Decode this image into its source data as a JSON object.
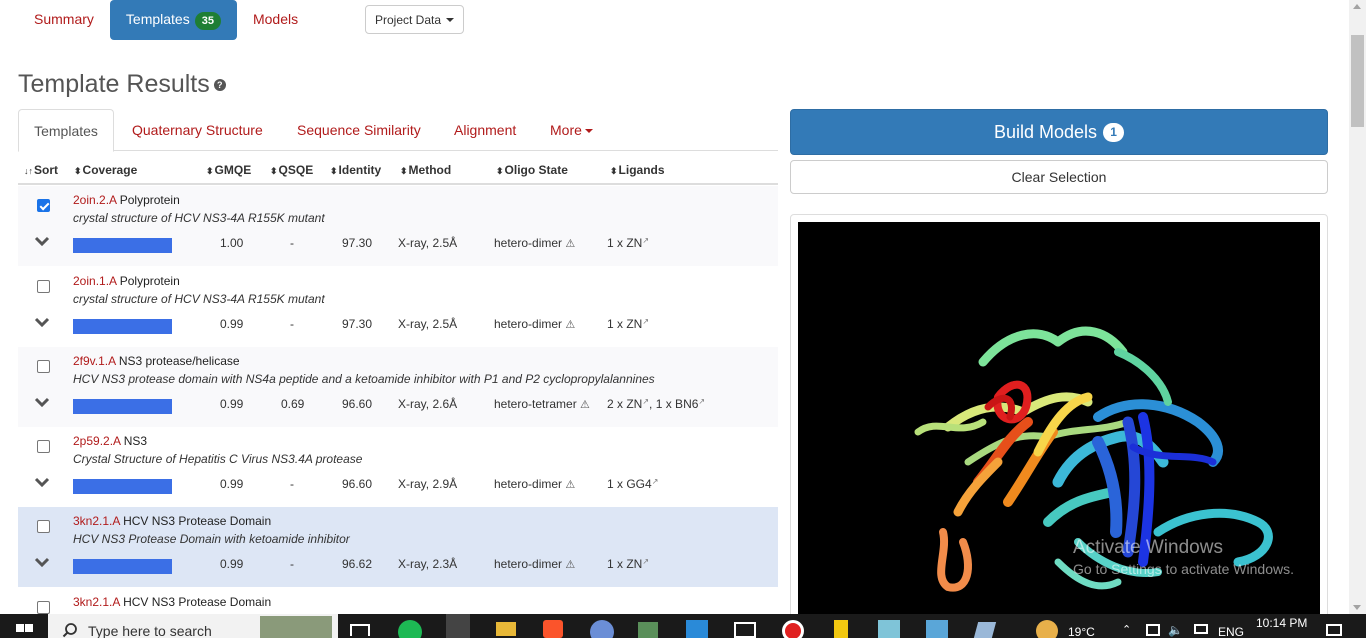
{
  "nav": {
    "tabs": [
      {
        "label": "Summary"
      },
      {
        "label": "Templates",
        "badge": "35"
      },
      {
        "label": "Models"
      }
    ],
    "project_data_label": "Project Data"
  },
  "title": "Template Results",
  "subtabs": [
    {
      "label": "Templates"
    },
    {
      "label": "Quaternary Structure"
    },
    {
      "label": "Sequence Similarity"
    },
    {
      "label": "Alignment"
    },
    {
      "label": "More"
    }
  ],
  "columns": {
    "sort": "Sort",
    "coverage": "Coverage",
    "gmqe": "GMQE",
    "qsqe": "QSQE",
    "identity": "Identity",
    "method": "Method",
    "oligo": "Oligo State",
    "ligands": "Ligands"
  },
  "rows": [
    {
      "checked": true,
      "id": "2oin.2.A",
      "name": "Polyprotein",
      "desc": "crystal structure of HCV NS3-4A R155K mutant",
      "gmqe": "1.00",
      "qsqe": "-",
      "identity": "97.30",
      "method": "X-ray, 2.5Å",
      "oligo": "hetero-dimer",
      "ligand1": "1 x ZN",
      "ligand2": ""
    },
    {
      "checked": false,
      "id": "2oin.1.A",
      "name": "Polyprotein",
      "desc": "crystal structure of HCV NS3-4A R155K mutant",
      "gmqe": "0.99",
      "qsqe": "-",
      "identity": "97.30",
      "method": "X-ray, 2.5Å",
      "oligo": "hetero-dimer",
      "ligand1": "1 x ZN",
      "ligand2": ""
    },
    {
      "checked": false,
      "id": "2f9v.1.A",
      "name": "NS3 protease/helicase",
      "desc": "HCV NS3 protease domain with NS4a peptide and a ketoamide inhibitor with P1 and P2 cyclopropylalannines",
      "gmqe": "0.99",
      "qsqe": "0.69",
      "identity": "96.60",
      "method": "X-ray, 2.6Å",
      "oligo": "hetero-tetramer",
      "ligand1": "2 x ZN",
      "ligand2": "1 x BN6"
    },
    {
      "checked": false,
      "id": "2p59.2.A",
      "name": "NS3",
      "desc": "Crystal Structure of Hepatitis C Virus NS3.4A protease",
      "gmqe": "0.99",
      "qsqe": "-",
      "identity": "96.60",
      "method": "X-ray, 2.9Å",
      "oligo": "hetero-dimer",
      "ligand1": "1 x GG4",
      "ligand2": ""
    },
    {
      "checked": false,
      "id": "3kn2.1.A",
      "name": "HCV NS3 Protease Domain",
      "desc": "HCV NS3 Protease Domain with ketoamide inhibitor",
      "gmqe": "0.99",
      "qsqe": "-",
      "identity": "96.62",
      "method": "X-ray, 2.3Å",
      "oligo": "hetero-dimer",
      "ligand1": "1 x ZN",
      "ligand2": ""
    },
    {
      "checked": false,
      "id": "3kn2.1.A",
      "name": "HCV NS3 Protease Domain",
      "desc": "",
      "gmqe": "",
      "qsqe": "",
      "identity": "",
      "method": "",
      "oligo": "",
      "ligand1": "",
      "ligand2": ""
    }
  ],
  "build": {
    "label": "Build Models",
    "count": "1"
  },
  "clear_label": "Clear Selection",
  "watermark": {
    "line1": "Activate Windows",
    "line2": "Go to Settings to activate Windows."
  },
  "taskbar": {
    "search_placeholder": "Type here to search",
    "temp": "19°C",
    "lang": "ENG",
    "time": "10:14 PM"
  }
}
